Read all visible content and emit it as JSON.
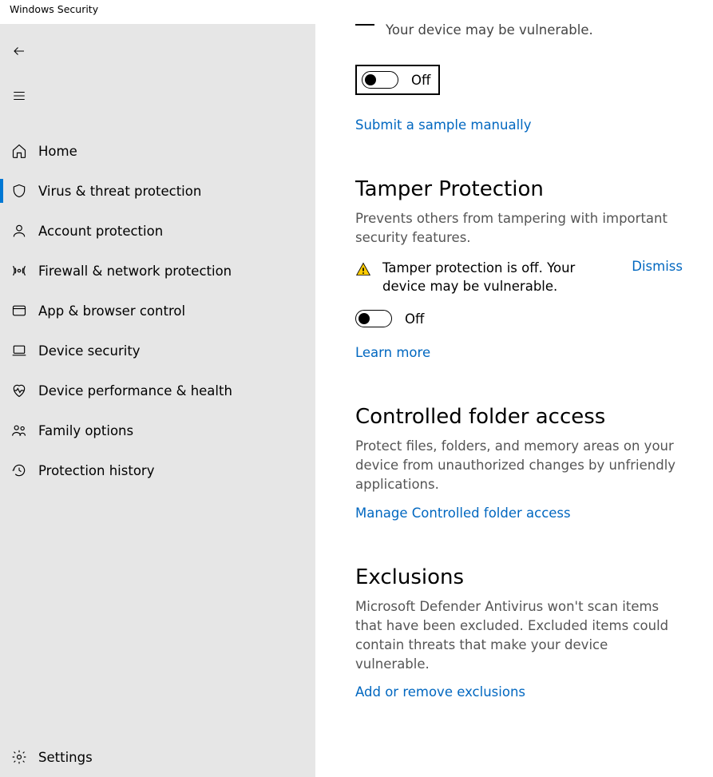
{
  "window": {
    "title": "Windows Security"
  },
  "sidebar": {
    "items": [
      {
        "label": "Home"
      },
      {
        "label": "Virus & threat protection"
      },
      {
        "label": "Account protection"
      },
      {
        "label": "Firewall & network protection"
      },
      {
        "label": "App & browser control"
      },
      {
        "label": "Device security"
      },
      {
        "label": "Device performance & health"
      },
      {
        "label": "Family options"
      },
      {
        "label": "Protection history"
      }
    ],
    "settings_label": "Settings"
  },
  "main": {
    "partial_warning": "Your device may be vulnerable.",
    "toggle1_state": "Off",
    "link_submit": "Submit a sample manually",
    "tamper": {
      "title": "Tamper Protection",
      "desc": "Prevents others from tampering with important security features.",
      "warning": "Tamper protection is off. Your device may be vulnerable.",
      "dismiss": "Dismiss",
      "toggle_state": "Off",
      "learn_more": "Learn more"
    },
    "cfa": {
      "title": "Controlled folder access",
      "desc": "Protect files, folders, and memory areas on your device from unauthorized changes by unfriendly applications.",
      "link": "Manage Controlled folder access"
    },
    "exclusions": {
      "title": "Exclusions",
      "desc": "Microsoft Defender Antivirus won't scan items that have been excluded. Excluded items could contain threats that make your device vulnerable.",
      "link": "Add or remove exclusions"
    }
  }
}
